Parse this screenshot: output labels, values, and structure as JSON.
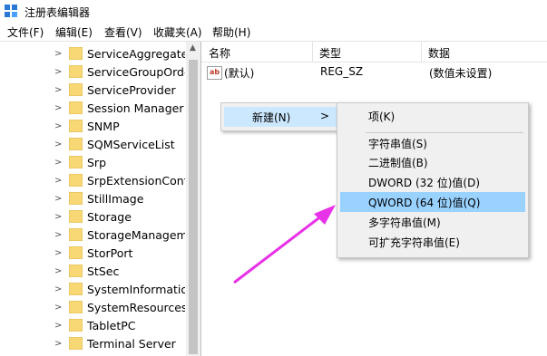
{
  "window": {
    "title": "注册表编辑器"
  },
  "menu": [
    "文件(F)",
    "编辑(E)",
    "查看(V)",
    "收藏夹(A)",
    "帮助(H)"
  ],
  "tree": {
    "items": [
      "ServiceAggregate",
      "ServiceGroupOrde",
      "ServiceProvider",
      "Session Manager",
      "SNMP",
      "SQMServiceList",
      "Srp",
      "SrpExtensionConfi",
      "StillImage",
      "Storage",
      "StorageManagem",
      "StorPort",
      "StSec",
      "SystemInformation",
      "SystemResources",
      "TabletPC",
      "Terminal Server"
    ]
  },
  "list": {
    "columns": [
      "名称",
      "类型",
      "数据"
    ],
    "rows": [
      {
        "icon": "ab",
        "name": "(默认)",
        "type": "REG_SZ",
        "data": "(数值未设置)"
      }
    ]
  },
  "context_menu": {
    "item": "新建(N)",
    "arrow": ">"
  },
  "submenu": {
    "items": [
      "项(K)",
      "字符串值(S)",
      "二进制值(B)",
      "DWORD (32 位)值(D)",
      "QWORD (64 位)值(Q)",
      "多字符串值(M)",
      "可扩充字符串值(E)"
    ],
    "highlighted_index": 4
  },
  "colors": {
    "highlight": "#99d1ff",
    "annotation_arrow": "#e832e8",
    "folder": "#f8d775"
  }
}
